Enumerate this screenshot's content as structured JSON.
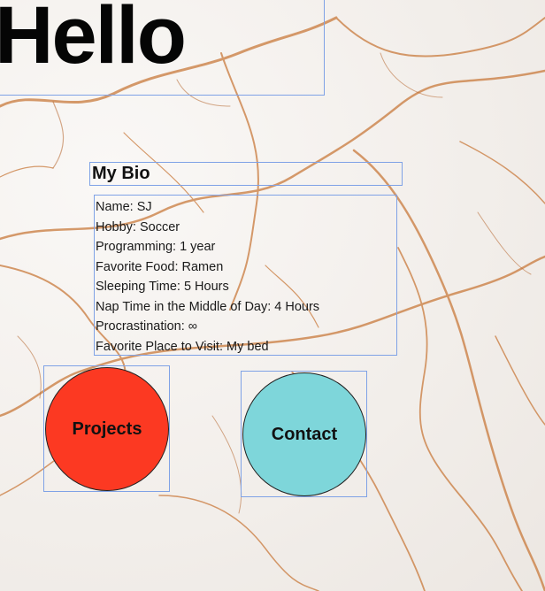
{
  "header": {
    "title": "Hello"
  },
  "bio": {
    "heading": "My Bio",
    "items": [
      "Name: SJ",
      "Hobby: Soccer",
      "Programming: 1 year",
      "Favorite Food: Ramen",
      "Sleeping Time: 5 Hours",
      "Nap Time in the Middle of Day: 4 Hours",
      "Procrastination: ∞",
      "Favorite Place to Visit: My bed"
    ]
  },
  "buttons": {
    "projects_label": "Projects",
    "contact_label": "Contact"
  },
  "colors": {
    "projects": "#fc3922",
    "contact": "#7ed6da",
    "outline": "#7fa2e6"
  }
}
